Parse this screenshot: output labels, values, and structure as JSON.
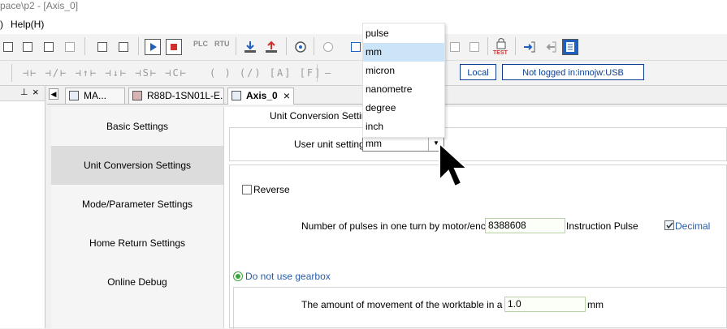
{
  "window": {
    "title": "pace\\p2 - [Axis_0]"
  },
  "menu": {
    "items": [
      {
        "label": ")"
      },
      {
        "label": "Help(H)"
      }
    ]
  },
  "toolbar": {
    "plc_label": "PLC",
    "rtu_label": "RTU",
    "test_label": "TEST"
  },
  "status": {
    "local": "Local",
    "login": "Not logged in:innojw:USB"
  },
  "tabs": [
    {
      "label": "MA..."
    },
    {
      "label": "R88D-1SN01L-E..."
    },
    {
      "label": "Axis_0"
    }
  ],
  "nav": {
    "items": [
      {
        "label": "Basic Settings"
      },
      {
        "label": "Unit Conversion Settings"
      },
      {
        "label": "Mode/Parameter Settings"
      },
      {
        "label": "Home Return Settings"
      },
      {
        "label": "Online Debug"
      }
    ]
  },
  "unit_conversion": {
    "section_title": "Unit Conversion Settings",
    "user_unit_label": "User unit setting:",
    "user_unit_value": "mm",
    "reverse_label": "Reverse",
    "pulses_label": "Number of pulses in one turn by motor/encoder:",
    "pulses_value": "8388608",
    "pulses_unit": "Instruction Pulse",
    "decimal_label": "Decimal",
    "gearbox_label": "Do not use gearbox",
    "movement_label": "The amount of movement of the worktable in a circle:",
    "movement_value": "1.0",
    "movement_unit": "mm"
  },
  "dropdown": {
    "options": [
      {
        "label": "pulse"
      },
      {
        "label": "mm"
      },
      {
        "label": "micron"
      },
      {
        "label": "nanometre"
      },
      {
        "label": "degree"
      },
      {
        "label": "inch"
      }
    ],
    "highlighted": "mm"
  },
  "colors": {
    "accent": "#0b3d91",
    "highlight": "#cce4f7",
    "selected_nav": "#dcdcdc"
  }
}
